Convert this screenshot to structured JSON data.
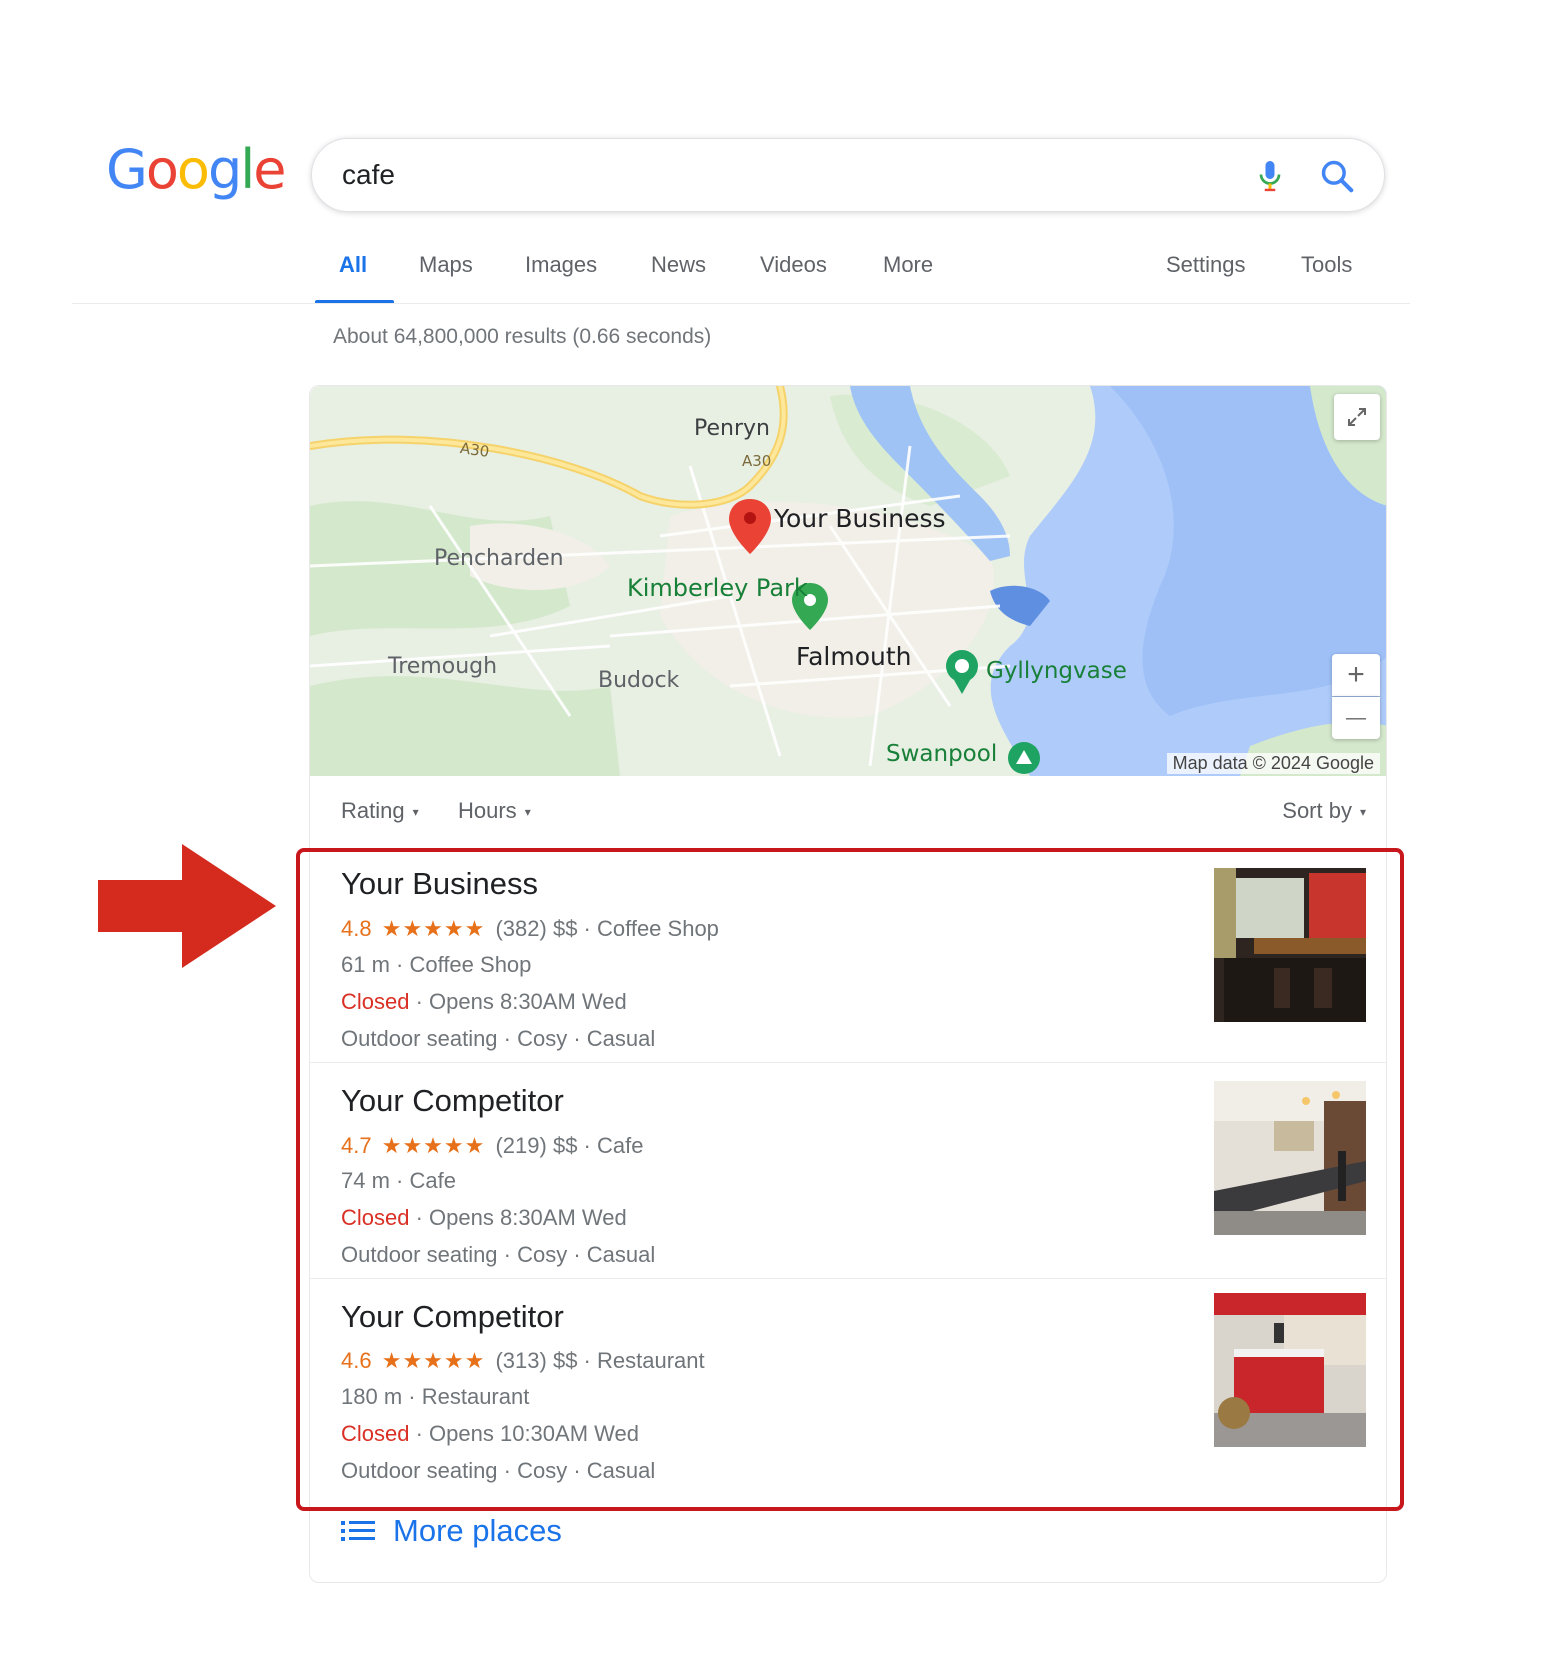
{
  "logo": {
    "letters": [
      "G",
      "o",
      "o",
      "g",
      "l",
      "e"
    ],
    "colors": [
      "#4285f4",
      "#ea4335",
      "#fbbc05",
      "#4285f4",
      "#34a853",
      "#ea4335"
    ]
  },
  "search": {
    "query": "cafe",
    "mic_icon": "mic-icon",
    "search_icon": "search-icon"
  },
  "tabs": [
    {
      "label": "All",
      "active": true
    },
    {
      "label": "Maps"
    },
    {
      "label": "Images"
    },
    {
      "label": "News"
    },
    {
      "label": "Videos"
    },
    {
      "label": "More"
    }
  ],
  "tools": {
    "settings": "Settings",
    "tools": "Tools"
  },
  "stats": "About 64,800,000 results (0.66 seconds)",
  "map": {
    "places": {
      "penryn": "Penryn",
      "road_a30_left": "A30",
      "road_a30_right": "A30",
      "your_business": "Your Business",
      "pencharden": "Pencharden",
      "kimberley_park": "Kimberley Park",
      "falmouth": "Falmouth",
      "gyllyngvase": "Gyllyngvase",
      "tremough": "Tremough",
      "budock": "Budock",
      "swanpool": "Swanpool"
    },
    "attribution": "Map data © 2024 Google",
    "controls": {
      "zoom_in": "+",
      "zoom_out": "—"
    }
  },
  "filters": {
    "rating": "Rating",
    "hours": "Hours",
    "sort_by": "Sort by"
  },
  "listings": [
    {
      "name": "Your Business",
      "rating": "4.8",
      "stars": "★★★★★",
      "reviews": "(382)",
      "price": "$$",
      "category": "Coffee Shop",
      "distance": "61 m",
      "type": "Coffee Shop",
      "status": "Closed",
      "opens": "Opens 8:30AM Wed",
      "attributes": "Outdoor seating · Cosy · Casual"
    },
    {
      "name": "Your Competitor",
      "rating": "4.7",
      "stars": "★★★★★",
      "reviews": "(219)",
      "price": "$$",
      "category": "Cafe",
      "distance": "74 m",
      "type": "Cafe",
      "status": "Closed",
      "opens": "Opens 8:30AM Wed",
      "attributes": "Outdoor seating · Cosy · Casual"
    },
    {
      "name": "Your Competitor",
      "rating": "4.6",
      "stars": "★★★★★",
      "reviews": "(313)",
      "price": "$$",
      "category": "Restaurant",
      "distance": "180 m",
      "type": "Restaurant",
      "status": "Closed",
      "opens": "Opens 10:30AM Wed",
      "attributes": "Outdoor seating · Cosy · Casual"
    }
  ],
  "more_places": "More places",
  "colors": {
    "accent": "#1a73e8",
    "rating": "#e7711b",
    "closed": "#d93025",
    "highlight": "#c8161d"
  }
}
